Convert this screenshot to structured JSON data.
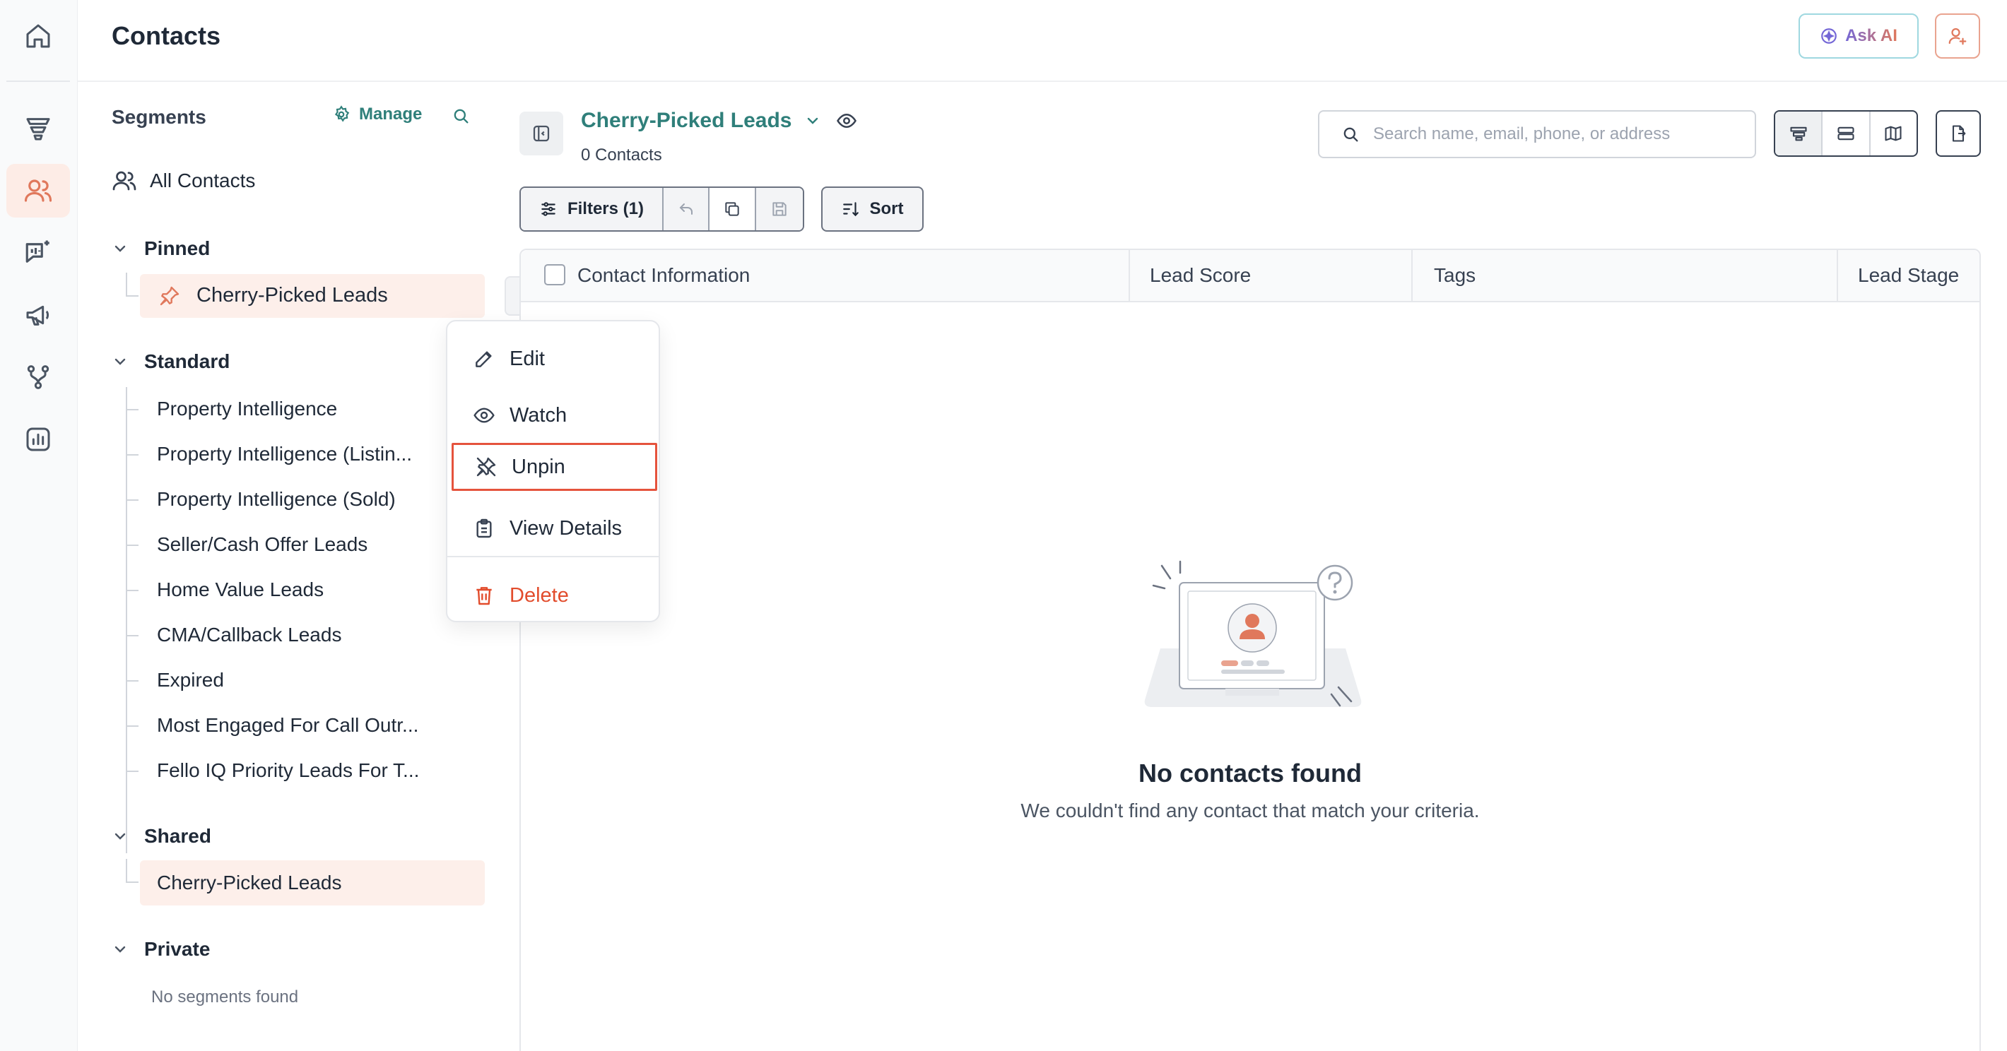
{
  "header": {
    "title": "Contacts",
    "ask_ai_label": "Ask AI"
  },
  "rail": {
    "items": [
      {
        "icon": "home-icon"
      },
      {
        "icon": "funnel-icon"
      },
      {
        "icon": "users-icon",
        "active": true
      },
      {
        "icon": "chat-sparkle-icon"
      },
      {
        "icon": "megaphone-icon"
      },
      {
        "icon": "workflow-icon"
      },
      {
        "icon": "report-icon"
      }
    ]
  },
  "segments": {
    "title": "Segments",
    "manage_label": "Manage",
    "all_contacts_label": "All Contacts",
    "groups": {
      "pinned": {
        "label": "Pinned",
        "items": [
          "Cherry-Picked Leads"
        ]
      },
      "standard": {
        "label": "Standard",
        "items": [
          "Property Intelligence",
          "Property Intelligence (Listin...",
          "Property Intelligence (Sold)",
          "Seller/Cash Offer Leads",
          "Home Value Leads",
          "CMA/Callback Leads",
          "Expired",
          "Most Engaged For Call Outr...",
          "Fello IQ Priority Leads For T..."
        ]
      },
      "shared": {
        "label": "Shared",
        "items": [
          "Cherry-Picked Leads"
        ]
      },
      "private": {
        "label": "Private",
        "empty_text": "No segments found"
      }
    }
  },
  "context_menu": {
    "items": [
      "Edit",
      "Watch",
      "Unpin",
      "View Details",
      "Delete"
    ],
    "highlighted": "Unpin"
  },
  "main": {
    "segment_name": "Cherry-Picked Leads",
    "contact_count": "0 Contacts",
    "search_placeholder": "Search name, email, phone, or address",
    "filters_label": "Filters (1)",
    "sort_label": "Sort",
    "columns": [
      "Contact Information",
      "Lead Score",
      "Tags",
      "Lead Stage"
    ],
    "empty_title": "No contacts found",
    "empty_subtitle": "We couldn't find any contact that match your criteria."
  },
  "colors": {
    "accent_teal": "#2f7f7a",
    "accent_coral": "#e0785c",
    "danger": "#e24c2c",
    "highlight_border": "#e5533d"
  }
}
